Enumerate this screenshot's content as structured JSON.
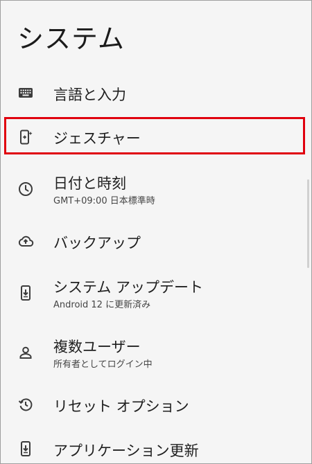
{
  "page": {
    "title": "システム"
  },
  "settings_items": [
    {
      "label": "言語と入力",
      "subtitle": "",
      "icon": "keyboard-icon"
    },
    {
      "label": "ジェスチャー",
      "subtitle": "",
      "icon": "gesture-phone-icon"
    },
    {
      "label": "日付と時刻",
      "subtitle": "GMT+09:00 日本標準時",
      "icon": "clock-icon"
    },
    {
      "label": "バックアップ",
      "subtitle": "",
      "icon": "cloud-upload-icon"
    },
    {
      "label": "システム アップデート",
      "subtitle": "Android 12 に更新済み",
      "icon": "system-update-icon"
    },
    {
      "label": "複数ユーザー",
      "subtitle": "所有者としてログイン中",
      "icon": "person-icon"
    },
    {
      "label": "リセット オプション",
      "subtitle": "",
      "icon": "history-icon"
    },
    {
      "label": "アプリケーション更新",
      "subtitle": "",
      "icon": "app-update-icon"
    }
  ],
  "highlight": {
    "target": "ジェスチャー",
    "color": "#e0000e"
  },
  "colors": {
    "background": "#f5f5f5",
    "text": "#1f1f1f",
    "icon": "#3c3c3c"
  }
}
